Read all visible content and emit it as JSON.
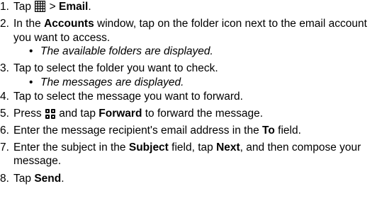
{
  "steps": [
    {
      "num": "1.",
      "parts": [
        "Tap ",
        " > ",
        "Email",
        "."
      ],
      "icon": "apps-grid-icon"
    },
    {
      "num": "2.",
      "parts": [
        "In the ",
        "Accounts",
        " window, tap on the folder icon next to the email account you want to access."
      ],
      "note": "The available folders are displayed."
    },
    {
      "num": "3.",
      "parts": [
        "Tap to select the folder you want to check."
      ],
      "note": "The messages are displayed."
    },
    {
      "num": "4.",
      "parts": [
        "Tap to select the message you want to forward."
      ]
    },
    {
      "num": "5.",
      "parts": [
        "Press ",
        " and tap ",
        "Forward",
        " to forward the message."
      ],
      "icon": "menu-key-icon"
    },
    {
      "num": "6.",
      "parts": [
        "Enter the message recipient's email address in the ",
        "To",
        " field."
      ]
    },
    {
      "num": "7.",
      "parts": [
        "Enter the subject in the ",
        "Subject",
        " field, tap ",
        "Next",
        ", and then compose your message."
      ]
    },
    {
      "num": "8.",
      "parts": [
        "Tap ",
        "Send",
        "."
      ]
    }
  ],
  "bullet": "•",
  "colors": {
    "text": "#000000",
    "icon": "#000000"
  }
}
